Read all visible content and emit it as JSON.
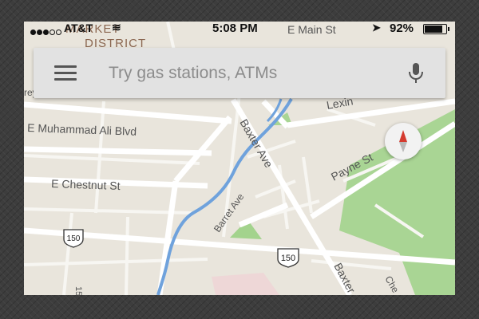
{
  "status_bar": {
    "carrier": "AT&T",
    "time": "5:08 PM",
    "battery_percent": "92%",
    "battery_level": 0.92
  },
  "search": {
    "placeholder": "Try gas stations, ATMs",
    "value": ""
  },
  "map": {
    "labels": {
      "district_line1": "MARKET",
      "district_line2": "DISTRICT",
      "e_main_st": "E Main St",
      "lexington": "Lexin",
      "muhammad_ali": "E Muhammad Ali Blvd",
      "baxter_ave": "Baxter Ave",
      "chestnut": "E Chestnut St",
      "payne_st": "Payne St",
      "barret_ave": "Barret Ave",
      "route_150": "150",
      "baxter_ave_lower": "Baxter",
      "partial_left": "15",
      "partial_right": "Che",
      "partial_top_left": "rey"
    }
  },
  "colors": {
    "map_background": "#e9e5dc",
    "road": "#ffffff",
    "river": "#6fa2dc",
    "park": "#a8d693",
    "compass_red": "#d43a2f"
  },
  "icons": {
    "menu": "hamburger-menu-icon",
    "mic": "microphone-icon",
    "compass": "compass-icon",
    "location": "location-arrow-icon"
  }
}
